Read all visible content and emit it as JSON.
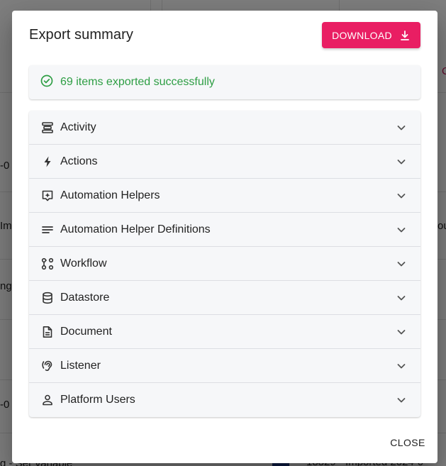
{
  "background": {
    "frag_1": "-0",
    "frag_2": "Im",
    "frag_3": "ng",
    "frag_4": "-0",
    "frag_5": "ou",
    "frag_6": "g - Set Variable",
    "frag_7": "18829 - Imported 2024-0",
    "accent_frag": "C"
  },
  "dialog": {
    "title": "Export summary",
    "download_label": "DOWNLOAD",
    "success_message": "69 items exported successfully",
    "close_label": "CLOSE",
    "colors": {
      "accent": "#e91e63",
      "success": "#2e9e44"
    },
    "sections": [
      {
        "label": "Activity",
        "icon": "activity-stack-icon"
      },
      {
        "label": "Actions",
        "icon": "lightning-bolt-icon"
      },
      {
        "label": "Automation Helpers",
        "icon": "sparkle-box-icon"
      },
      {
        "label": "Automation Helper Definitions",
        "icon": "lines-icon"
      },
      {
        "label": "Workflow",
        "icon": "workflow-icon"
      },
      {
        "label": "Datastore",
        "icon": "database-icon"
      },
      {
        "label": "Document",
        "icon": "document-icon"
      },
      {
        "label": "Listener",
        "icon": "ear-icon"
      },
      {
        "label": "Platform Users",
        "icon": "person-icon"
      }
    ]
  }
}
